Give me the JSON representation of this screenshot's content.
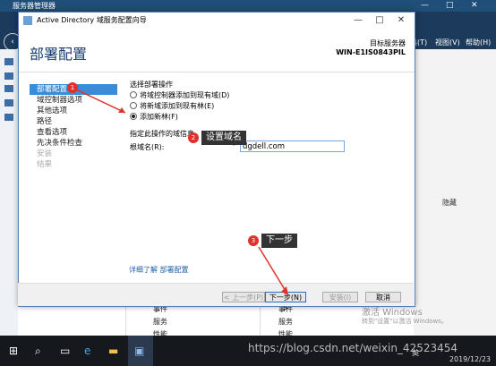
{
  "server_manager": {
    "title": "服务器管理器",
    "menu": [
      "工具(T)",
      "视图(V)",
      "帮助(H)"
    ],
    "right_pane_label": "隐藏",
    "bottom_left": [
      "事件",
      "服务",
      "性能"
    ],
    "bottom_right": [
      "事件",
      "服务",
      "性能"
    ]
  },
  "dialog": {
    "title": "Active Directory 域服务配置向导",
    "heading": "部署配置",
    "target_server_label": "目标服务器",
    "target_server_value": "WIN-E1IS0843PIL",
    "steps": [
      {
        "label": "部署配置",
        "state": "active"
      },
      {
        "label": "域控制器选项",
        "state": "normal"
      },
      {
        "label": "其他选项",
        "state": "normal"
      },
      {
        "label": "路径",
        "state": "normal"
      },
      {
        "label": "查看选项",
        "state": "normal"
      },
      {
        "label": "先决条件检查",
        "state": "normal"
      },
      {
        "label": "安装",
        "state": "disabled"
      },
      {
        "label": "结果",
        "state": "disabled"
      }
    ],
    "select_op_label": "选择部署操作",
    "options": [
      {
        "label": "将域控制器添加到现有域(D)",
        "selected": false
      },
      {
        "label": "将新域添加到现有林(E)",
        "selected": false
      },
      {
        "label": "添加新林(F)",
        "selected": true
      }
    ],
    "domain_info_label": "指定此操作的域信息",
    "root_domain_label": "根域名(R):",
    "root_domain_value": "dgdell.com",
    "more_link": "详细了解 部署配置",
    "buttons": {
      "prev": "< 上一步(P)",
      "next": "下一步(N) >",
      "install": "安装(I)",
      "cancel": "取消"
    }
  },
  "annotations": {
    "badge1": "1",
    "badge2": "2",
    "badge3": "3",
    "tip2": "设置域名",
    "tip3": "下一步"
  },
  "watermark": {
    "line1": "激活 Windows",
    "line2": "转到\"设置\"以激活 Windows。"
  },
  "taskbar": {
    "url": "https://blog.csdn.net/weixin_42523454",
    "ime": "英",
    "date": "2019/12/23"
  }
}
